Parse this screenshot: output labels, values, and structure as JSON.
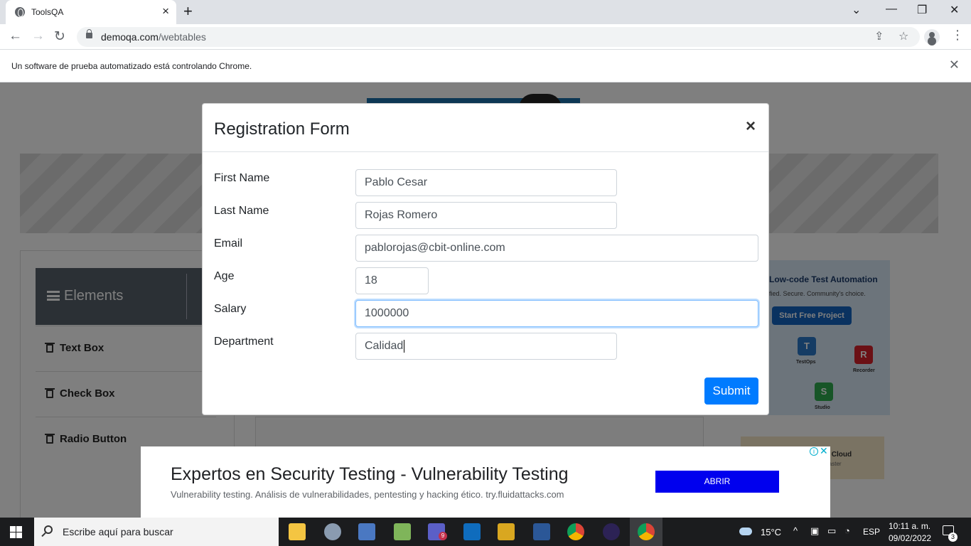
{
  "browser": {
    "tab_title": "ToolsQA",
    "url_host": "demoqa.com",
    "url_path": "/webtables",
    "infobar_text": "Un software de prueba automatizado está controlando Chrome."
  },
  "sidebar": {
    "group_label": "Elements",
    "items": [
      {
        "label": "Text Box"
      },
      {
        "label": "Check Box"
      },
      {
        "label": "Radio Button"
      }
    ]
  },
  "side_ad": {
    "title": "Low-code Test Automation",
    "subtitle": "fied. Secure. Community's choice.",
    "button": "Start Free Project",
    "badges": [
      "TestOps",
      "Recorder",
      "Studio"
    ]
  },
  "side_ad2": {
    "text": "ting On Cloud",
    "sub": "hip Faster"
  },
  "modal": {
    "title": "Registration Form",
    "close_glyph": "×",
    "fields": [
      {
        "label": "First Name",
        "value": "Pablo Cesar"
      },
      {
        "label": "Last Name",
        "value": "Rojas Romero"
      },
      {
        "label": "Email",
        "value": "pablorojas@cbit-online.com"
      },
      {
        "label": "Age",
        "value": "18"
      },
      {
        "label": "Salary",
        "value": "1000000"
      },
      {
        "label": "Department",
        "value": "Calidad"
      }
    ],
    "submit_label": "Submit"
  },
  "bottom_ad": {
    "headline": "Expertos en Security Testing - Vulnerability Testing",
    "body": "Vulnerability testing. Análisis de vulnerabilidades, pentesting y hacking ético. try.fluidattacks.com",
    "button": "ABRIR"
  },
  "taskbar": {
    "search_placeholder": "Escribe aquí para buscar",
    "temperature": "15°C",
    "language": "ESP",
    "time": "10:11 a. m.",
    "date": "09/02/2022",
    "notification_count": "3",
    "teams_badge": "9"
  },
  "colors": {
    "primary": "#007bff",
    "sidebar_header": "#56606b",
    "taskbar": "#1b1c1e",
    "ad_button": "#0000ee"
  }
}
